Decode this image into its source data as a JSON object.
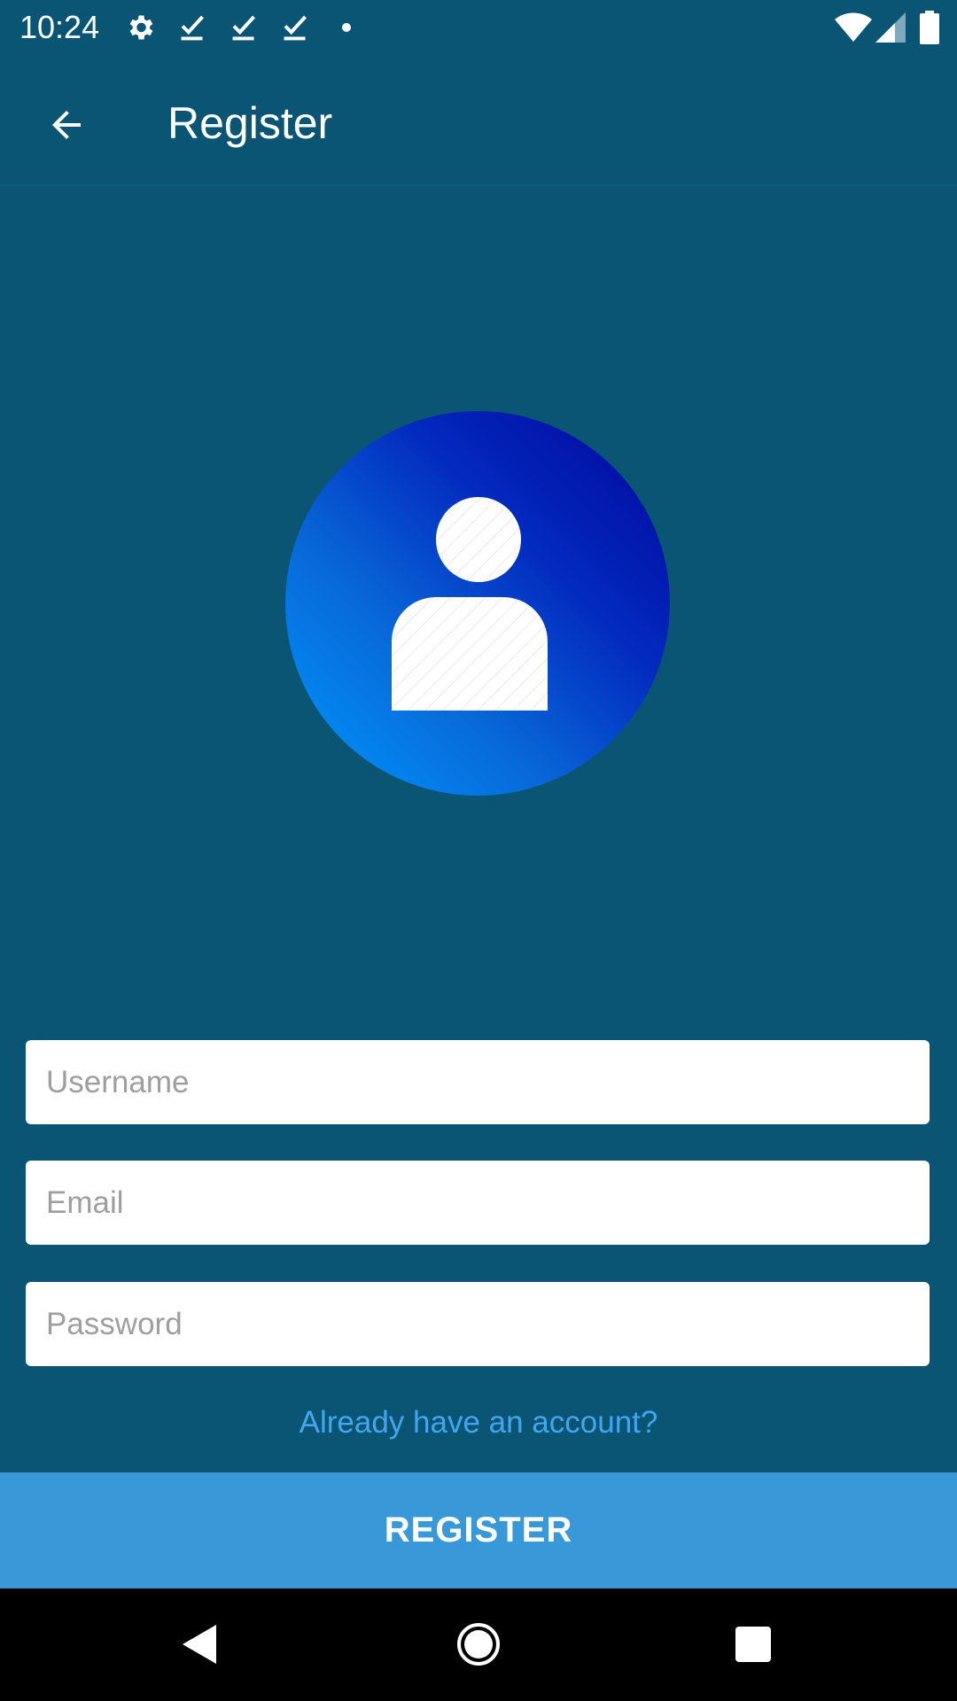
{
  "status_bar": {
    "time": "10:24",
    "icons_left": [
      "settings-icon",
      "check-icon",
      "check-icon",
      "check-icon",
      "dot-icon"
    ],
    "icons_right": [
      "wifi-icon",
      "signal-icon",
      "battery-icon"
    ]
  },
  "app_bar": {
    "title": "Register",
    "back_icon": "arrow-back-icon"
  },
  "avatar": {
    "icon": "person-icon",
    "gradient_colors": [
      "#0098ff",
      "#00049a"
    ]
  },
  "form": {
    "username_placeholder": "Username",
    "email_placeholder": "Email",
    "password_placeholder": "Password",
    "username_value": "",
    "email_value": "",
    "password_value": ""
  },
  "login_link": "Already have an account?",
  "register_button": "REGISTER",
  "nav_bar": {
    "back": "nav-back-icon",
    "home": "nav-home-icon",
    "recents": "nav-recents-icon"
  },
  "colors": {
    "background": "#0a5574",
    "accent": "#3898d8",
    "link": "#42a5f0"
  }
}
